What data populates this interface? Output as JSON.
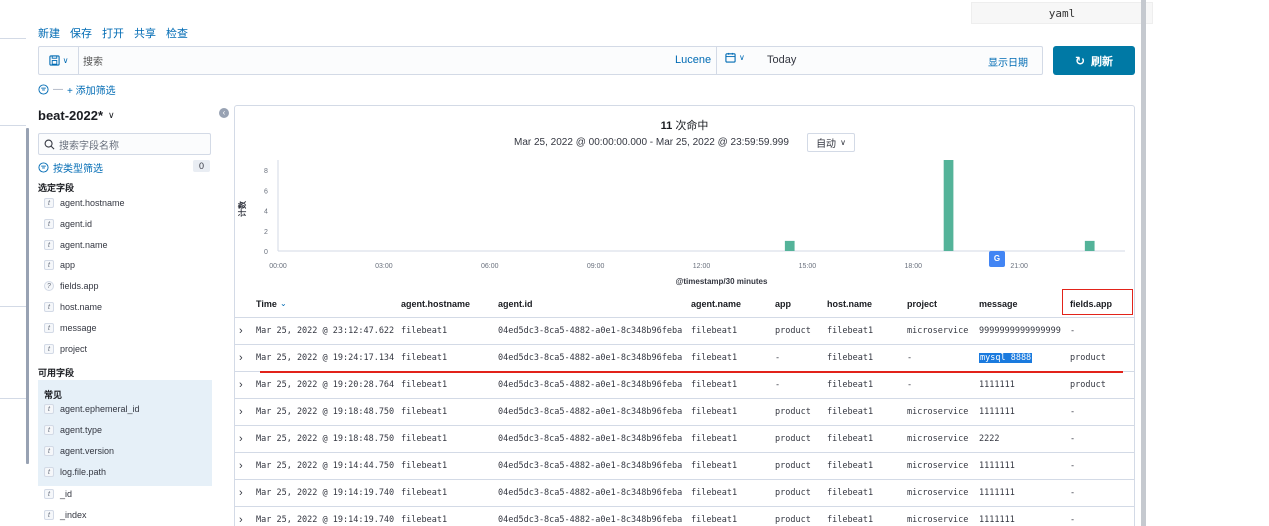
{
  "window": {
    "tab_title": "yaml"
  },
  "top_menu": [
    "新建",
    "保存",
    "打开",
    "共享",
    "检查"
  ],
  "query_bar": {
    "placeholder": "搜索",
    "language": "Lucene",
    "time_value": "Today",
    "show_dates": "显示日期",
    "refresh_label": "刷新"
  },
  "filter_bar": {
    "add_filter": "+ 添加筛选"
  },
  "sidebar": {
    "index_pattern": "beat-2022*",
    "search_placeholder": "搜索字段名称",
    "type_filter_label": "按类型筛选",
    "type_filter_count": "0",
    "selected_title": "选定字段",
    "selected_fields": [
      {
        "type": "t",
        "name": "agent.hostname"
      },
      {
        "type": "t",
        "name": "agent.id"
      },
      {
        "type": "t",
        "name": "agent.name"
      },
      {
        "type": "t",
        "name": "app"
      },
      {
        "type": "?",
        "name": "fields.app"
      },
      {
        "type": "t",
        "name": "host.name"
      },
      {
        "type": "t",
        "name": "message"
      },
      {
        "type": "t",
        "name": "project"
      }
    ],
    "available_title": "可用字段",
    "popular_title": "常见",
    "popular_fields": [
      {
        "type": "t",
        "name": "agent.ephemeral_id"
      },
      {
        "type": "t",
        "name": "agent.type"
      },
      {
        "type": "t",
        "name": "agent.version"
      },
      {
        "type": "t",
        "name": "log.file.path"
      }
    ],
    "other_fields": [
      {
        "type": "t",
        "name": "_id"
      },
      {
        "type": "t",
        "name": "_index"
      }
    ]
  },
  "results": {
    "hits_count": "11",
    "hits_suffix": " 次命中",
    "time_range": "Mar 25, 2022 @ 00:00:00.000 - Mar 25, 2022 @ 23:59:59.999",
    "interval": "自动"
  },
  "chart_data": {
    "type": "bar",
    "title": "",
    "xlabel": "@timestamp/30 minutes",
    "ylabel": "计数",
    "ylim": [
      0,
      9
    ],
    "y_ticks": [
      "0",
      "2",
      "4",
      "6",
      "8"
    ],
    "x_ticks": [
      "00:00",
      "03:00",
      "06:00",
      "09:00",
      "12:00",
      "15:00",
      "18:00",
      "21:00"
    ],
    "x_tick_hours": [
      0,
      3,
      6,
      9,
      12,
      15,
      18,
      21
    ],
    "x_range_hours": [
      0,
      24
    ],
    "bars": [
      {
        "hour": 14.5,
        "value": 1
      },
      {
        "hour": 19.0,
        "value": 9
      },
      {
        "hour": 23.0,
        "value": 1
      }
    ],
    "bar_color": "#54b399",
    "grid": false
  },
  "table": {
    "columns": [
      "Time",
      "agent.hostname",
      "agent.id",
      "agent.name",
      "app",
      "host.name",
      "project",
      "message",
      "fields.app"
    ],
    "rows": [
      [
        "Mar 25, 2022 @ 23:12:47.622",
        "filebeat1",
        "04ed5dc3-8ca5-4882-a0e1-8c348b96feba",
        "filebeat1",
        "product",
        "filebeat1",
        "microservice",
        "9999999999999999",
        "-"
      ],
      [
        "Mar 25, 2022 @ 19:24:17.134",
        "filebeat1",
        "04ed5dc3-8ca5-4882-a0e1-8c348b96feba",
        "filebeat1",
        "-",
        "filebeat1",
        "-",
        "mysql 8888",
        "product"
      ],
      [
        "Mar 25, 2022 @ 19:20:28.764",
        "filebeat1",
        "04ed5dc3-8ca5-4882-a0e1-8c348b96feba",
        "filebeat1",
        "-",
        "filebeat1",
        "-",
        "1111111",
        "product"
      ],
      [
        "Mar 25, 2022 @ 19:18:48.750",
        "filebeat1",
        "04ed5dc3-8ca5-4882-a0e1-8c348b96feba",
        "filebeat1",
        "product",
        "filebeat1",
        "microservice",
        "1111111",
        "-"
      ],
      [
        "Mar 25, 2022 @ 19:18:48.750",
        "filebeat1",
        "04ed5dc3-8ca5-4882-a0e1-8c348b96feba",
        "filebeat1",
        "product",
        "filebeat1",
        "microservice",
        "2222",
        "-"
      ],
      [
        "Mar 25, 2022 @ 19:14:44.750",
        "filebeat1",
        "04ed5dc3-8ca5-4882-a0e1-8c348b96feba",
        "filebeat1",
        "product",
        "filebeat1",
        "microservice",
        "1111111",
        "-"
      ],
      [
        "Mar 25, 2022 @ 19:14:19.740",
        "filebeat1",
        "04ed5dc3-8ca5-4882-a0e1-8c348b96feba",
        "filebeat1",
        "product",
        "filebeat1",
        "microservice",
        "1111111",
        "-"
      ],
      [
        "Mar 25, 2022 @ 19:14:19.740",
        "filebeat1",
        "04ed5dc3-8ca5-4882-a0e1-8c348b96feba",
        "filebeat1",
        "product",
        "filebeat1",
        "microservice",
        "1111111",
        "-"
      ]
    ],
    "highlighted_cell": {
      "row": 1,
      "col": 7
    }
  },
  "colors": {
    "accent": "#006bb4",
    "refresh": "#0079a5",
    "bar": "#54b399",
    "annotation": "#e2231a"
  }
}
